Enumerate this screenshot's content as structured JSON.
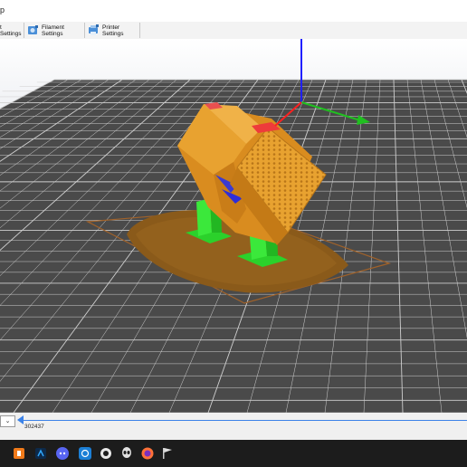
{
  "menu": {
    "fragment": "p"
  },
  "tabs": [
    {
      "label": "t Settings",
      "icon": "print-settings-icon"
    },
    {
      "label": "Filament Settings",
      "icon": "filament-settings-icon"
    },
    {
      "label": "Printer Settings",
      "icon": "printer-settings-icon"
    }
  ],
  "viewport": {
    "bed_color": "#4a4a4a",
    "grid_color": "#cfcfcf",
    "model_color": "#e8a230",
    "support_color": "#33dd33",
    "brim_color": "#8a5a1a",
    "axis_colors": {
      "x": "#ff2020",
      "y": "#20c020",
      "z": "#2020ff"
    }
  },
  "bottom": {
    "combo_symbol": "⌄",
    "layer_value": "302437"
  },
  "taskbar": {
    "icons": [
      "orange-app-icon",
      "photoshop-icon",
      "discord-icon",
      "vpn-icon",
      "steam-icon",
      "alien-icon",
      "firefox-icon",
      "flag-icon"
    ]
  }
}
